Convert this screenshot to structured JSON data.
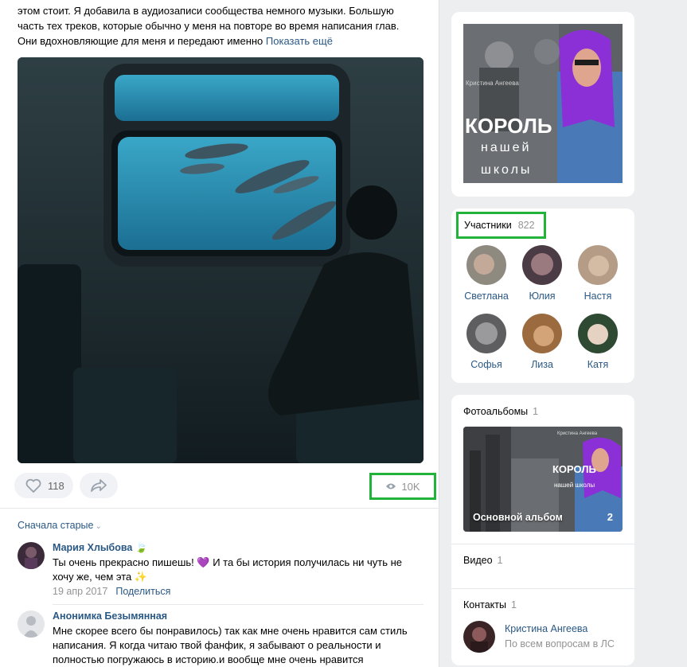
{
  "post": {
    "text_line1": "этом стоит. Я добавила в аудиозаписи сообщества немного музыки. Большую",
    "text_line2": "часть тех треков, которые обычно у меня на повторе во время написания глав.",
    "text_line3": "Они вдохновляющие для меня и передают именно",
    "show_more": "Показать ещё",
    "likes": "118",
    "views": "10K"
  },
  "comments": {
    "sort_label": "Сначала старые",
    "items": [
      {
        "author": "Мария Хлыбова",
        "author_emoji": "🍃",
        "text_line1": "Ты очень прекрасно пишешь! 💜 И та бы история получилась ни чуть не",
        "text_line2": "хочу же, чем эта ✨",
        "date": "19 апр 2017",
        "share": "Поделиться"
      },
      {
        "author": "Анонимка Безымянная",
        "text_line1": "Мне скорее всего бы понравилось) так как мне очень нравится сам стиль",
        "text_line2": "написания. Я когда читаю твой фанфик, я забывают о реальности и",
        "text_line3": "полностью погружаюсь в историю.и вообще мне очень нравится"
      }
    ]
  },
  "sidebar": {
    "cover": {
      "author": "Кристина Ангеева",
      "title": "КОРОЛЬ",
      "subtitle1": "нашей",
      "subtitle2": "школы"
    },
    "members": {
      "title": "Участники",
      "count": "822",
      "people": [
        "Светлана",
        "Юлия",
        "Настя",
        "Софья",
        "Лиза",
        "Катя"
      ]
    },
    "albums": {
      "title": "Фотоальбомы",
      "count": "1",
      "album_name": "Основной альбом",
      "album_count": "2",
      "album_cover_author": "Кристина Ангеева",
      "album_cover_title": "КОРОЛЬ",
      "album_cover_subtitle": "нашей школы"
    },
    "video": {
      "title": "Видео",
      "count": "1"
    },
    "contacts": {
      "title": "Контакты",
      "count": "1",
      "name": "Кристина Ангеева",
      "desc": "По всем вопросам в ЛС"
    }
  },
  "colors": {
    "link": "#2a5885",
    "highlight": "#22b33a",
    "muted": "#939393",
    "page_bg": "#edeef0"
  }
}
